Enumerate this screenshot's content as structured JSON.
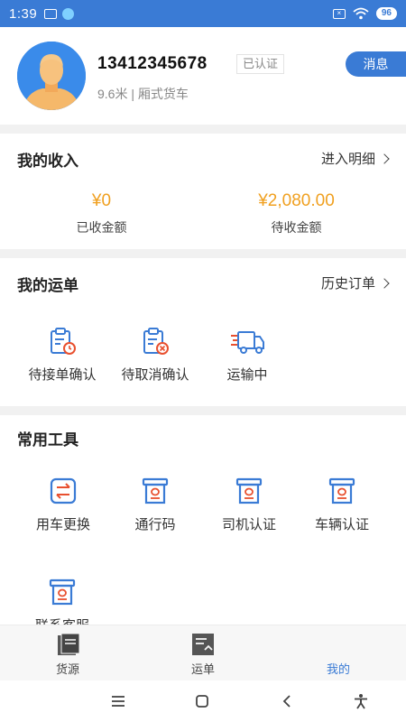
{
  "status_bar": {
    "time": "1:39",
    "battery": "96",
    "icons": [
      "notification-icon",
      "app-icon",
      "sim-icon",
      "wifi-icon",
      "battery-icon"
    ]
  },
  "profile": {
    "phone": "13412345678",
    "verified_badge": "已认证",
    "vehicle_info": "9.6米 | 厢式货车",
    "message_button": "消息"
  },
  "income": {
    "title": "我的收入",
    "detail_link": "进入明细",
    "received_amount": "¥0",
    "received_label": "已收金额",
    "pending_amount": "¥2,080.00",
    "pending_label": "待收金额"
  },
  "orders": {
    "title": "我的运单",
    "history_link": "历史订单",
    "items": [
      {
        "label": "待接单确认",
        "icon": "clipboard-clock-icon"
      },
      {
        "label": "待取消确认",
        "icon": "clipboard-cancel-icon"
      },
      {
        "label": "运输中",
        "icon": "truck-icon"
      }
    ]
  },
  "tools": {
    "title": "常用工具",
    "items": [
      {
        "label": "用车更换",
        "icon": "swap-icon"
      },
      {
        "label": "通行码",
        "icon": "pass-code-icon"
      },
      {
        "label": "司机认证",
        "icon": "driver-cert-icon"
      },
      {
        "label": "车辆认证",
        "icon": "vehicle-cert-icon"
      },
      {
        "label": "联系客服",
        "icon": "customer-service-icon"
      }
    ]
  },
  "tabbar": {
    "tabs": [
      {
        "label": "货源",
        "icon": "cargo-icon"
      },
      {
        "label": "运单",
        "icon": "waybill-icon"
      },
      {
        "label": "我的",
        "icon": "me-icon"
      }
    ],
    "active_color": "#3a7bd5"
  },
  "colors": {
    "brand": "#3a7bd5",
    "amount": "#f0a020",
    "icon_accent": "#e8502f"
  }
}
